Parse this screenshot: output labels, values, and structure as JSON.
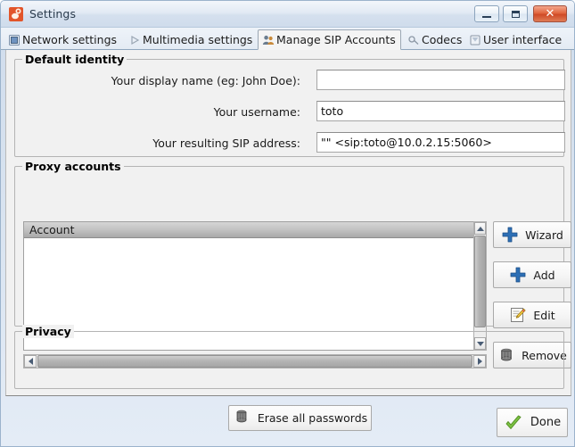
{
  "window": {
    "title": "Settings",
    "icon": "app-icon",
    "controls": {
      "minimize": "minimize-button",
      "maximize": "maximize-button",
      "close": "close-button"
    }
  },
  "tabs": [
    {
      "label": "Network settings",
      "icon": "network-icon",
      "selected": false
    },
    {
      "label": "Multimedia settings",
      "icon": "play-icon",
      "selected": false
    },
    {
      "label": "Manage SIP Accounts",
      "icon": "users-icon",
      "selected": true
    },
    {
      "label": "Codecs",
      "icon": "link-icon",
      "selected": false
    },
    {
      "label": "User interface",
      "icon": "window-icon",
      "selected": false
    }
  ],
  "identity": {
    "group_title": "Default identity",
    "fields": [
      {
        "label": "Your display name (eg: John Doe):",
        "value": "",
        "placeholder": ""
      },
      {
        "label": "Your username:",
        "value": "toto",
        "placeholder": ""
      },
      {
        "label": "Your resulting SIP address:",
        "value": "\"\" <sip:toto@10.0.2.15:5060>",
        "placeholder": ""
      }
    ]
  },
  "proxy": {
    "group_title": "Proxy accounts",
    "columns": [
      "Account"
    ],
    "rows": [],
    "buttons": [
      {
        "label": "Wizard",
        "icon": "plus-icon"
      },
      {
        "label": "Add",
        "icon": "plus-icon"
      },
      {
        "label": "Edit",
        "icon": "pencil-icon"
      },
      {
        "label": "Remove",
        "icon": "trash-icon"
      }
    ]
  },
  "privacy": {
    "group_title": "Privacy",
    "erase_label": "Erase all passwords",
    "erase_icon": "trash-icon"
  },
  "footer": {
    "done_label": "Done",
    "done_icon": "check-icon"
  },
  "colors": {
    "accent": "#3a6ea5",
    "close_button": "#cf4a26",
    "check_green": "#7bc043",
    "plus_blue": "#2d6fb5",
    "content_bg": "#f1f1f1",
    "titlebar": "#cfdcec"
  }
}
